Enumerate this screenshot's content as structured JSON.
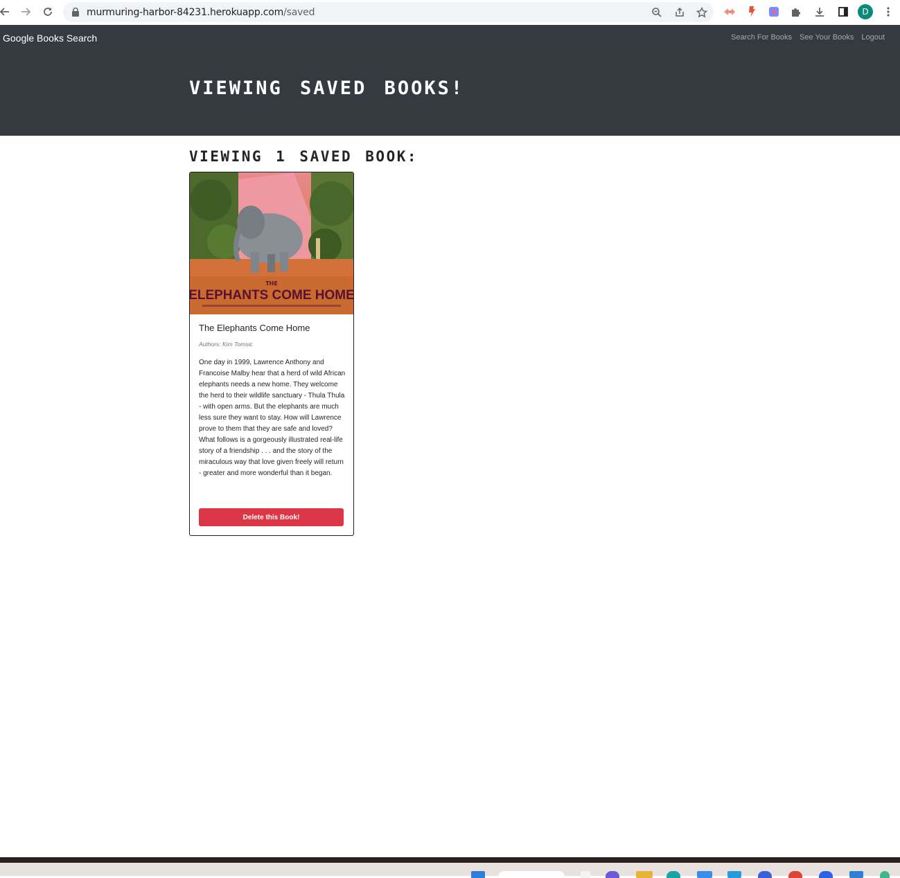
{
  "browser": {
    "url_host": "murmuring-harbor-84231.herokuapp.com",
    "url_path": "/saved",
    "profile_initial": "D",
    "icons": [
      "back-icon",
      "forward-icon",
      "reload-icon",
      "lock-icon",
      "zoom-icon",
      "share-icon",
      "bookmark-star-icon",
      "extension-icon",
      "extensions-puzzle-icon",
      "download-icon",
      "side-panel-icon",
      "menu-icon"
    ]
  },
  "navbar": {
    "brand": "Google Books Search",
    "links": [
      "Search For Books",
      "See Your Books",
      "Logout"
    ]
  },
  "header": {
    "title": "Viewing saved books!"
  },
  "main": {
    "count_heading": "Viewing 1 saved book:",
    "books": [
      {
        "title": "The Elephants Come Home",
        "authors": "Authors: Kim Tomsic",
        "description": "One day in 1999, Lawrence Anthony and Francoise Malby hear that a herd of wild African elephants needs a new home. They welcome the herd to their wildlife sanctuary - Thula Thula - with open arms. But the elephants are much less sure they want to stay. How will Lawrence prove to them that they are safe and loved? What follows is a gorgeously illustrated real-life story of a friendship . . . and the story of the miraculous way that love given freely will return - greater and more wonderful than it began.",
        "cover_text_the": "THE",
        "cover_text_title": "ELEPHANTS COME HOME",
        "delete_label": "Delete this Book!"
      }
    ]
  },
  "colors": {
    "navbar_bg": "#343a40",
    "danger": "#dc3545"
  }
}
